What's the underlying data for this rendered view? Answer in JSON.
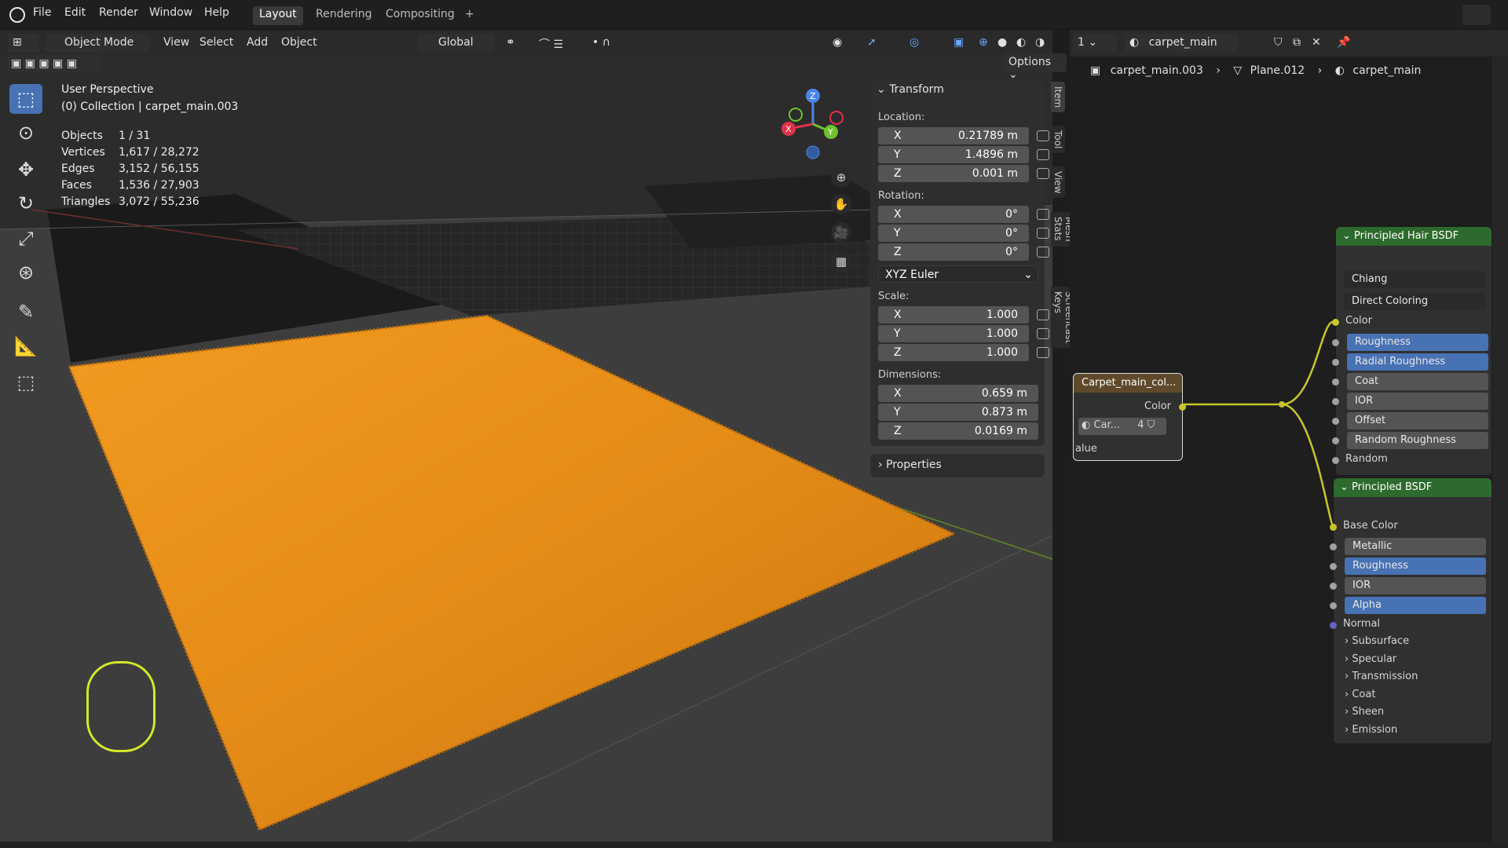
{
  "topbar": {
    "menus": [
      "File",
      "Edit",
      "Render",
      "Window",
      "Help"
    ],
    "workspaces": [
      "Layout",
      "Rendering",
      "Compositing"
    ],
    "add_label": "+"
  },
  "viewport_header": {
    "mode": "Object Mode",
    "menus": [
      "View",
      "Select",
      "Add",
      "Object"
    ],
    "orientation": "Global",
    "options": "Options"
  },
  "overlay": {
    "view_name": "User Perspective",
    "collection": "(0) Collection | carpet_main.003",
    "stats": [
      {
        "label": "Objects",
        "value": "1 / 31"
      },
      {
        "label": "Vertices",
        "value": "1,617 / 28,272"
      },
      {
        "label": "Edges",
        "value": "3,152 / 56,155"
      },
      {
        "label": "Faces",
        "value": "1,536 / 27,903"
      },
      {
        "label": "Triangles",
        "value": "3,072 / 55,236"
      }
    ]
  },
  "gizmo": {
    "x": "X",
    "y": "Y",
    "z": "Z"
  },
  "transform": {
    "title": "Transform",
    "location_label": "Location:",
    "rotation_label": "Rotation:",
    "scale_label": "Scale:",
    "dimensions_label": "Dimensions:",
    "location": [
      {
        "axis": "X",
        "value": "0.21789 m"
      },
      {
        "axis": "Y",
        "value": "1.4896 m"
      },
      {
        "axis": "Z",
        "value": "0.001 m"
      }
    ],
    "rotation": [
      {
        "axis": "X",
        "value": "0°"
      },
      {
        "axis": "Y",
        "value": "0°"
      },
      {
        "axis": "Z",
        "value": "0°"
      }
    ],
    "rotation_mode": "XYZ Euler",
    "scale": [
      {
        "axis": "X",
        "value": "1.000"
      },
      {
        "axis": "Y",
        "value": "1.000"
      },
      {
        "axis": "Z",
        "value": "1.000"
      }
    ],
    "dimensions": [
      {
        "axis": "X",
        "value": "0.659 m"
      },
      {
        "axis": "Y",
        "value": "0.873 m"
      },
      {
        "axis": "Z",
        "value": "0.0169 m"
      }
    ]
  },
  "properties_label": "Properties",
  "side_tabs": [
    "Item",
    "Tool",
    "View",
    "Mesh Stats",
    "Screencast Keys"
  ],
  "node_header": {
    "slot": "1",
    "material": "carpet_main"
  },
  "breadcrumbs": [
    "carpet_main.003",
    "Plane.012",
    "carpet_main"
  ],
  "texture_node": {
    "title": "Carpet_main_col...",
    "output": "Color",
    "image": "Car...",
    "users": "4",
    "alpha": "alue"
  },
  "hair_node": {
    "title": "Principled Hair BSDF",
    "model": "Chiang",
    "parametrization": "Direct Coloring",
    "color_socket": "Color",
    "inputs": [
      {
        "label": "Roughness",
        "style": "blue"
      },
      {
        "label": "Radial Roughness",
        "style": "blue"
      },
      {
        "label": "Coat",
        "style": "grey"
      },
      {
        "label": "IOR",
        "style": "grey"
      },
      {
        "label": "Offset",
        "style": "grey"
      },
      {
        "label": "Random Roughness",
        "style": "grey"
      }
    ],
    "random": "Random"
  },
  "bsdf_node": {
    "title": "Principled BSDF",
    "base_color": "Base Color",
    "inputs": [
      {
        "label": "Metallic",
        "style": "grey"
      },
      {
        "label": "Roughness",
        "style": "blue"
      },
      {
        "label": "IOR",
        "style": "grey"
      },
      {
        "label": "Alpha",
        "style": "blue"
      }
    ],
    "normal": "Normal",
    "panels": [
      "Subsurface",
      "Specular",
      "Transmission",
      "Coat",
      "Sheen",
      "Emission"
    ]
  },
  "colors": {
    "accent": "#4772b3",
    "carpet": "#e8901c",
    "node_header": "#2d6a2d",
    "link": "#c7c729"
  }
}
